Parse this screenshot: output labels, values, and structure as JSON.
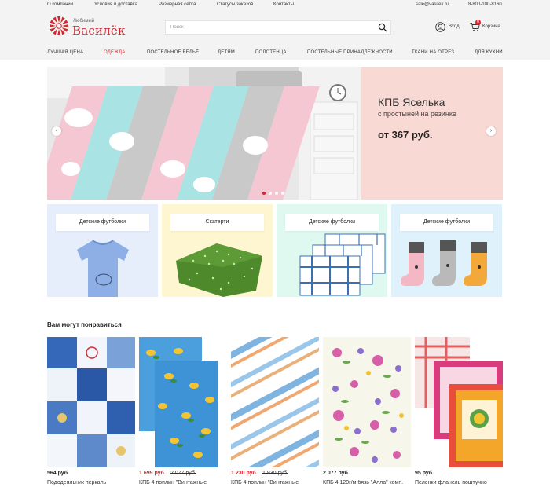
{
  "topbar": {
    "links": [
      "О компании",
      "Условия и доставка",
      "Размерная сетка",
      "Статусы заказов",
      "Контакты"
    ],
    "email": "sale@vasilek.ru",
    "phone": "8-800-100-8160"
  },
  "header": {
    "logo_small": "Любимый",
    "logo_big": "Василёк",
    "search_placeholder": "Поиск",
    "search_value": "",
    "login_label": "Вход",
    "cart_label": "Корзина",
    "cart_count": "0"
  },
  "nav": {
    "items": [
      "ЛУЧШАЯ ЦЕНА",
      "ОДЕЖДА",
      "ПОСТЕЛЬНОЕ БЕЛЬЁ",
      "ДЕТЯМ",
      "ПОЛОТЕНЦА",
      "ПОСТЕЛЬНЫЕ ПРИНАДЛЕЖНОСТИ",
      "ТКАНИ НА ОТРЕЗ",
      "ДЛЯ КУХНИ"
    ],
    "active_index": 1
  },
  "hero": {
    "title": "КПБ Яселька",
    "subtitle": "с простыней на резинке",
    "price": "от 367 руб.",
    "prev_icon": "chevron-left-icon",
    "next_icon": "chevron-right-icon",
    "slides": 4,
    "active_slide": 0
  },
  "categories": [
    {
      "label": "Детские футболки",
      "bg": "#e6eefb"
    },
    {
      "label": "Скатерти",
      "bg": "#fdf6d0"
    },
    {
      "label": "Детские футболки",
      "bg": "#dff8f0"
    },
    {
      "label": "Детские футболки",
      "bg": "#dff1fb"
    }
  ],
  "recommendations": {
    "title": "Вам могут понравиться",
    "items": [
      {
        "price": "564 руб.",
        "old_price": "",
        "name": "Пододеяльник перкаль"
      },
      {
        "price": "1 699 руб.",
        "old_price": "2 077 руб.",
        "name": "КПБ 4 поплин \"Винтажные"
      },
      {
        "price": "1 230 руб.",
        "old_price": "1 930 руб.",
        "name": "КПБ 4 поплин \"Винтажные"
      },
      {
        "price": "2 077 руб.",
        "old_price": "",
        "name": "КПБ 4 120г/м бязь \"Алла\" комп."
      },
      {
        "price": "95 руб.",
        "old_price": "",
        "name": "Пеленки фланель поштучно"
      }
    ]
  },
  "colors": {
    "accent": "#d7282f",
    "hero_bg": "#f9d9d3",
    "header_bg": "#f3f3f3"
  }
}
